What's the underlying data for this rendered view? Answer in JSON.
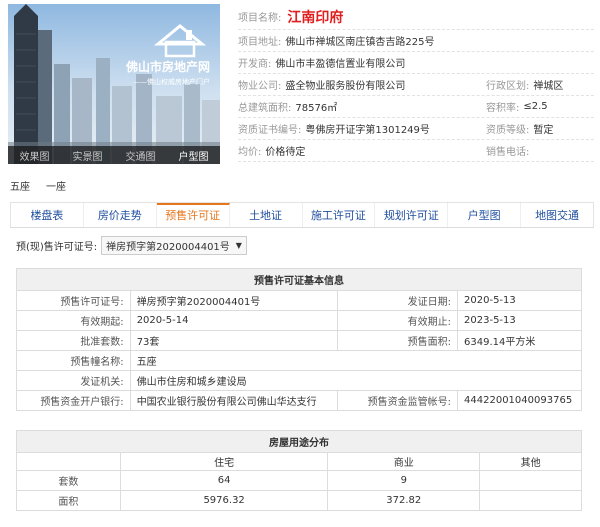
{
  "photo": {
    "logo_line1": "佛山市房地产网",
    "logo_line2": "——佛山权威房地产门户",
    "tabs": [
      {
        "label": "效果图",
        "active": false
      },
      {
        "label": "实景图",
        "active": false
      },
      {
        "label": "交通图",
        "active": false
      },
      {
        "label": "户型图",
        "active": true
      }
    ]
  },
  "project": {
    "name_label": "项目名称:",
    "name": "江南印府",
    "address_label": "项目地址:",
    "address": "佛山市禅城区南庄镇杏吉路225号",
    "developer_label": "开发商:",
    "developer": "佛山市丰盈德信置业有限公司",
    "property_label": "物业公司:",
    "property": "盛全物业服务股份有限公司",
    "district_label": "行政区划:",
    "district": "禅城区",
    "area_label": "总建筑面积:",
    "area": "78576㎡",
    "plot_ratio_label": "容积率:",
    "plot_ratio": "≤2.5",
    "cert_label": "资质证书编号:",
    "cert": "粤佛房开证字第1301249号",
    "grade_label": "资质等级:",
    "grade": "暂定",
    "price_label": "均价:",
    "price": "价格待定",
    "phone_label": "销售电话:",
    "phone": ""
  },
  "buildings": [
    "五座",
    "一座"
  ],
  "tabs": [
    {
      "label": "楼盘表",
      "active": false
    },
    {
      "label": "房价走势",
      "active": false
    },
    {
      "label": "预售许可证",
      "active": true
    },
    {
      "label": "土地证",
      "active": false
    },
    {
      "label": "施工许可证",
      "active": false
    },
    {
      "label": "规划许可证",
      "active": false
    },
    {
      "label": "户型图",
      "active": false
    },
    {
      "label": "地图交通",
      "active": false
    }
  ],
  "permit_selector": {
    "label": "预(现)售许可证号:",
    "value": "禅房预字第2020004401号"
  },
  "permit_table": {
    "caption": "预售许可证基本信息",
    "rows": [
      [
        {
          "k": "预售许可证号:",
          "v": "禅房预字第2020004401号"
        },
        {
          "k": "发证日期:",
          "v": "2020-5-13"
        }
      ],
      [
        {
          "k": "有效期起:",
          "v": "2020-5-14"
        },
        {
          "k": "有效期止:",
          "v": "2023-5-13"
        }
      ],
      [
        {
          "k": "批准套数:",
          "v": "73套"
        },
        {
          "k": "预售面积:",
          "v": "6349.14平方米"
        }
      ]
    ],
    "building_label": "预售幢名称:",
    "building": "五座",
    "authority_label": "发证机关:",
    "authority": "佛山市住房和城乡建设局",
    "bank_label": "预售资金开户银行:",
    "bank": "中国农业银行股份有限公司佛山华达支行",
    "account_label": "预售资金监管帐号:",
    "account": "44422001040093765"
  },
  "usage_table": {
    "caption": "房屋用途分布",
    "columns": [
      "住宅",
      "商业",
      "其他"
    ],
    "rows": [
      {
        "label": "套数",
        "values": [
          "64",
          "9",
          ""
        ]
      },
      {
        "label": "面积",
        "values": [
          "5976.32",
          "372.82",
          ""
        ]
      }
    ]
  }
}
